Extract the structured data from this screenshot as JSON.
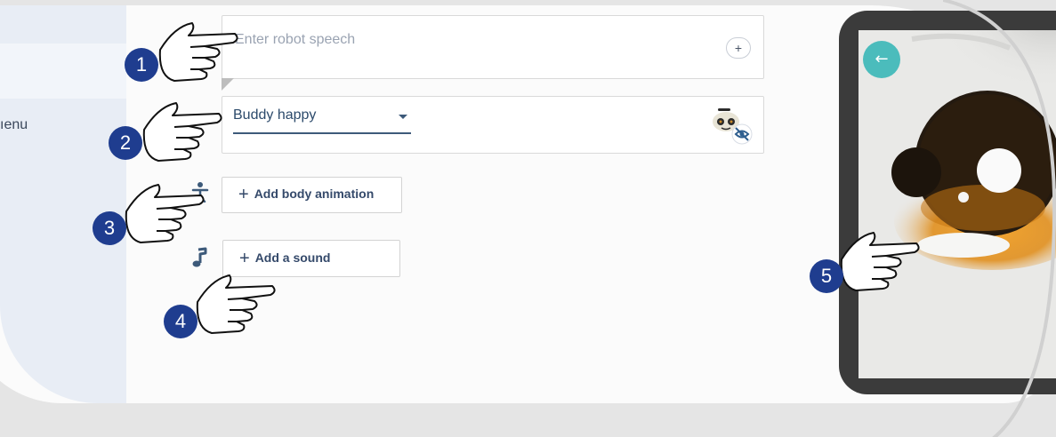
{
  "sidebar": {
    "menu_label": "ıenu"
  },
  "speech": {
    "placeholder": "Enter robot speech",
    "add_label": "+"
  },
  "emotion": {
    "selected": "Buddy happy"
  },
  "actions": {
    "body_animation_label": "Add body animation",
    "sound_label": "Add a sound"
  },
  "tablet": {
    "back_label": "←"
  },
  "callouts": [
    "1",
    "2",
    "3",
    "4",
    "5"
  ],
  "colors": {
    "page_background": "#e5e5e5",
    "panel": "#fbfbfb",
    "sidebar": "#e8edf5",
    "text_primary": "#2c4a6b",
    "badge": "#1f3d8f",
    "teal": "#4bbcbc",
    "tablet_frame": "#3b3b3b"
  },
  "icons": {
    "speech_add": "plus-circle-icon",
    "emotion_caret": "caret-down-icon",
    "robot_face": "robot-face-hidden-icon",
    "body_animation": "person-icon",
    "sound": "music-note-icon",
    "tablet_back": "arrow-left-icon",
    "callout_hand": "pointing-hand-icon"
  }
}
